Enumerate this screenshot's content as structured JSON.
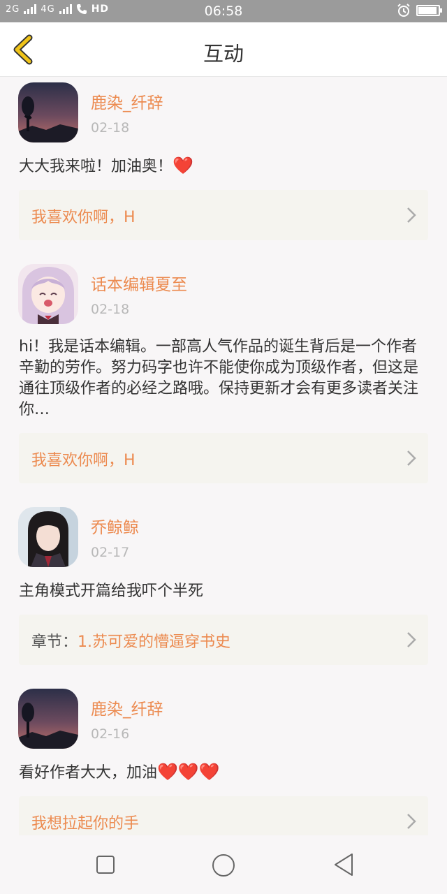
{
  "status": {
    "signal_left": "2G",
    "signal_mid": "4G",
    "hd": "HD",
    "time": "06:58"
  },
  "header": {
    "title": "互动",
    "back_icon": "chevron-left-icon"
  },
  "comments": [
    {
      "name": "鹿染_纤辞",
      "date": "02-18",
      "content": "大大我来啦！加油奥！",
      "hearts": "❤️",
      "link_prefix": "",
      "link_text": "我喜欢你啊，H"
    },
    {
      "name": "话本编辑夏至",
      "date": "02-18",
      "content": "hi！我是话本编辑。一部高人气作品的诞生背后是一个作者辛勤的劳作。努力码字也许不能使你成为顶级作者，但这是通往顶级作者的必经之路哦。保持更新才会有更多读者关注你…",
      "link_prefix": "",
      "link_text": "我喜欢你啊，H"
    },
    {
      "name": "乔鲸鲸",
      "date": "02-17",
      "content": "主角模式开篇给我吓个半死",
      "link_prefix": "章节：",
      "link_text": "1.苏可爱的懵逼穿书史"
    },
    {
      "name": "鹿染_纤辞",
      "date": "02-16",
      "content": "看好作者大大，加油",
      "hearts": "❤️❤️❤️",
      "link_prefix": "",
      "link_text": "我想拉起你的手"
    }
  ],
  "colors": {
    "accent": "#ec8a4f",
    "back_arrow": "#f0c419",
    "card_bg": "#f5f4ef"
  }
}
